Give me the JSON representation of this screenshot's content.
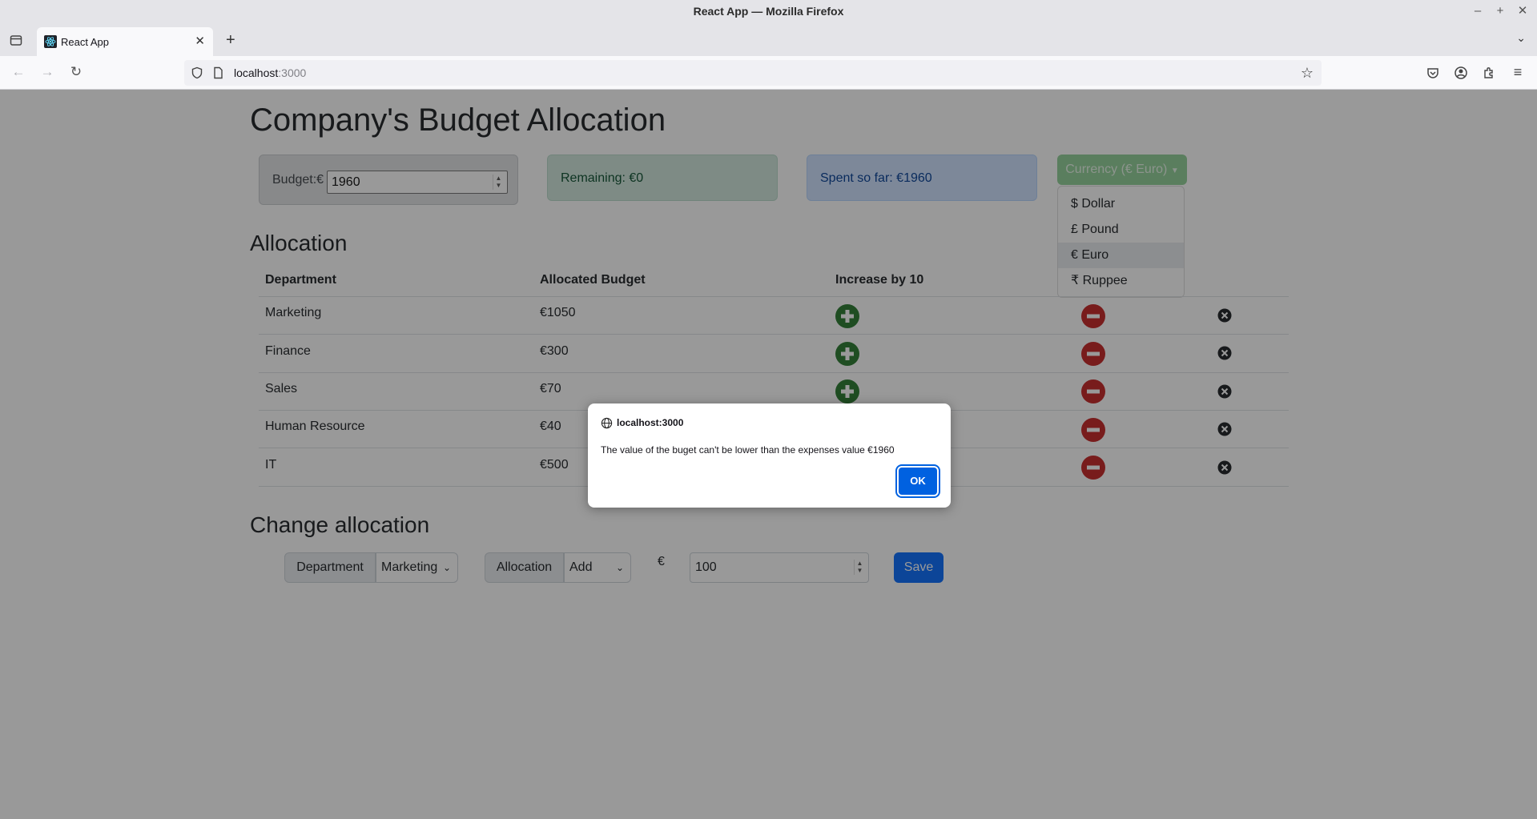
{
  "window": {
    "title": "React App — Mozilla Firefox"
  },
  "browser": {
    "tab_title": "React App",
    "url_host": "localhost",
    "url_port": ":3000"
  },
  "page": {
    "title": "Company's Budget Allocation",
    "budget_label": "Budget:€",
    "budget_value": "1960",
    "remaining_text": "Remaining: €0",
    "spent_text": "Spent so far: €1960",
    "currency_button": "Currency (€ Euro)",
    "currency_options": [
      "$ Dollar",
      "£ Pound",
      "€ Euro",
      "₹ Ruppee"
    ],
    "currency_selected": "€ Euro",
    "allocation_heading": "Allocation",
    "table_headers": [
      "Department",
      "Allocated Budget",
      "Increase by 10"
    ],
    "rows": [
      {
        "department": "Marketing",
        "budget": "€1050"
      },
      {
        "department": "Finance",
        "budget": "€300"
      },
      {
        "department": "Sales",
        "budget": "€70"
      },
      {
        "department": "Human Resource",
        "budget": "€40"
      },
      {
        "department": "IT",
        "budget": "€500"
      }
    ],
    "change_heading": "Change allocation",
    "department_label": "Department",
    "department_selected": "Marketing",
    "allocation_label": "Allocation",
    "allocation_selected": "Add",
    "currency_symbol": "€",
    "amount_value": "100",
    "save_label": "Save"
  },
  "dialog": {
    "origin": "localhost:3000",
    "message": "The value of the buget can't be lower than the expenses value €1960",
    "ok_label": "OK"
  },
  "colors": {
    "increase": "#2e7d32",
    "decrease": "#c62828",
    "remove": "#212529",
    "primary": "#0d6efd"
  }
}
